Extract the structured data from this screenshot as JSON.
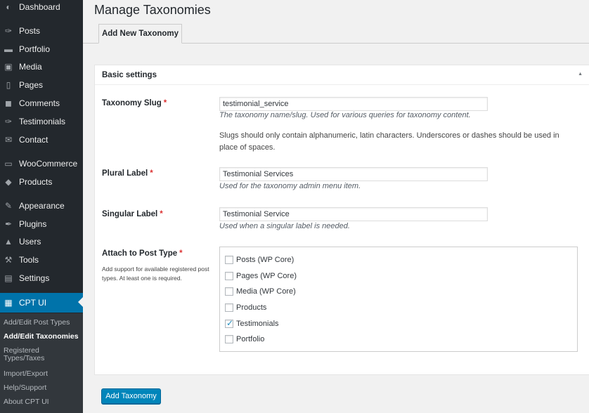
{
  "sidebar": {
    "items": [
      {
        "label": "Dashboard",
        "icon": "dashboard-icon",
        "glyph": "◐"
      },
      {
        "label": "Posts",
        "icon": "pin-icon",
        "glyph": "✑"
      },
      {
        "label": "Portfolio",
        "icon": "folder-icon",
        "glyph": "▬"
      },
      {
        "label": "Media",
        "icon": "media-icon",
        "glyph": "▣"
      },
      {
        "label": "Pages",
        "icon": "pages-icon",
        "glyph": "▯"
      },
      {
        "label": "Comments",
        "icon": "comment-icon",
        "glyph": "◼"
      },
      {
        "label": "Testimonials",
        "icon": "pin-icon",
        "glyph": "✑"
      },
      {
        "label": "Contact",
        "icon": "mail-icon",
        "glyph": "✉"
      },
      {
        "label": "WooCommerce",
        "icon": "woocommerce-icon",
        "glyph": "▭"
      },
      {
        "label": "Products",
        "icon": "box-icon",
        "glyph": "◆"
      },
      {
        "label": "Appearance",
        "icon": "brush-icon",
        "glyph": "✎"
      },
      {
        "label": "Plugins",
        "icon": "plug-icon",
        "glyph": "✒"
      },
      {
        "label": "Users",
        "icon": "user-icon",
        "glyph": "▲"
      },
      {
        "label": "Tools",
        "icon": "wrench-icon",
        "glyph": "⚒"
      },
      {
        "label": "Settings",
        "icon": "settings-icon",
        "glyph": "▤"
      },
      {
        "label": "CPT UI",
        "icon": "cptui-icon",
        "glyph": "▦"
      }
    ],
    "submenu": [
      "Add/Edit Post Types",
      "Add/Edit Taxonomies",
      "Registered Types/Taxes",
      "Import/Export",
      "Help/Support",
      "About CPT UI"
    ]
  },
  "page": {
    "title": "Manage Taxonomies",
    "tab_label": "Add New Taxonomy"
  },
  "box": {
    "title": "Basic settings",
    "toggle": "▲"
  },
  "form": {
    "required_mark": "*",
    "slug": {
      "label": "Taxonomy Slug",
      "value": "testimonial_service",
      "description": "The taxonomy name/slug. Used for various queries for taxonomy content.",
      "note": "Slugs should only contain alphanumeric, latin characters. Underscores or dashes should be used in place of spaces."
    },
    "plural": {
      "label": "Plural Label",
      "value": "Testimonial Services",
      "description": "Used for the taxonomy admin menu item."
    },
    "singular": {
      "label": "Singular Label",
      "value": "Testimonial Service",
      "description": "Used when a singular label is needed."
    },
    "attach": {
      "label": "Attach to Post Type",
      "description": "Add support for available registered post types. At least one is required.",
      "options": [
        {
          "label": "Posts (WP Core)",
          "checked": false
        },
        {
          "label": "Pages (WP Core)",
          "checked": false
        },
        {
          "label": "Media (WP Core)",
          "checked": false
        },
        {
          "label": "Products",
          "checked": false
        },
        {
          "label": "Testimonials",
          "checked": true
        },
        {
          "label": "Portfolio",
          "checked": false
        }
      ]
    },
    "submit_label": "Add Taxonomy"
  }
}
